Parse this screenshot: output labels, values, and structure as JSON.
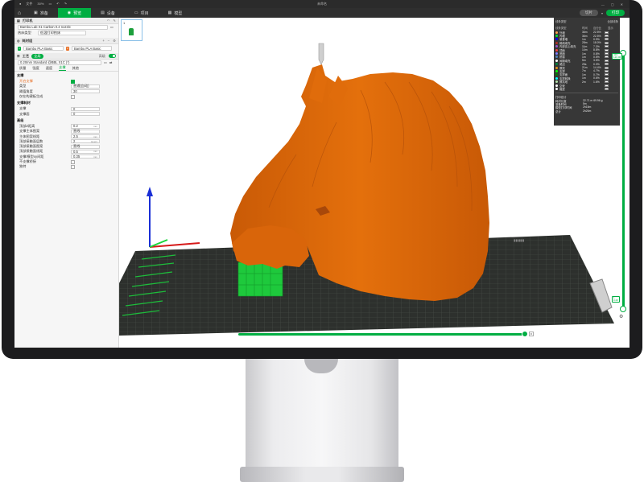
{
  "titlebar": {
    "file_menu": "文件",
    "zoom": "30%",
    "title": "未命名"
  },
  "navbar": {
    "home_icon": "home-icon",
    "tabs": [
      {
        "label": "准备",
        "active": false
      },
      {
        "label": "预览",
        "active": true
      },
      {
        "label": "设备",
        "active": false
      },
      {
        "label": "项目",
        "active": false
      },
      {
        "label": "模型",
        "active": false
      }
    ],
    "slice_button": "切片",
    "print_button": "打印"
  },
  "left_panel": {
    "printer_section": "打印机",
    "printer_name": "Bambu Lab X1 Carbon 0.4 nozzle",
    "plate_type_label": "热床类型",
    "plate_type_value": "低温打印热床",
    "filament_section": "耗材组",
    "filaments": [
      {
        "index": "1",
        "name": "Bambu PLA Basic",
        "color": "#00ae42"
      },
      {
        "index": "2",
        "name": "Bambu PLA Basic",
        "color": "#e8722b"
      }
    ],
    "process_section": "工艺",
    "process_badge": "全局",
    "advanced_label": "高级",
    "profile_value": "0.20mm Standard @BBL X1C (*)",
    "subtabs": [
      "质量",
      "强度",
      "速度",
      "支撑",
      "其他"
    ],
    "active_subtab": "支撑",
    "groups": [
      {
        "title": "支撑",
        "params": [
          {
            "label": "开启支撑",
            "value": "",
            "type": "checkbox",
            "checked": true,
            "orange": true
          },
          {
            "label": "类型",
            "value": "普通(自动)",
            "type": "select"
          },
          {
            "label": "阈值角度",
            "value": "30",
            "type": "value",
            "unit": ""
          },
          {
            "label": "仅在构建板生成",
            "value": "",
            "type": "checkbox",
            "checked": false
          }
        ]
      },
      {
        "title": "支撑耗材",
        "params": [
          {
            "label": "支撑",
            "value": "0",
            "type": "select"
          },
          {
            "label": "支撑面",
            "value": "0",
            "type": "select"
          }
        ]
      },
      {
        "title": "高级",
        "params": [
          {
            "label": "顶部Z距离",
            "value": "0.2",
            "type": "value",
            "unit": "mm"
          },
          {
            "label": "支撑主体图案",
            "value": "直线",
            "type": "select"
          },
          {
            "label": "主体图案线距",
            "value": "2.5",
            "type": "value",
            "unit": "mm"
          },
          {
            "label": "顶部接触面层数",
            "value": "2",
            "type": "value",
            "unit": "layers"
          },
          {
            "label": "顶部接触面图案",
            "value": "直线",
            "type": "select"
          },
          {
            "label": "顶部接触面线距",
            "value": "0.5",
            "type": "value",
            "unit": "mm"
          },
          {
            "label": "支撑/模型xy间距",
            "value": "0.35",
            "type": "value",
            "unit": "mm"
          },
          {
            "label": "不支撑桥接",
            "value": "",
            "type": "checkbox",
            "checked": false
          },
          {
            "label": "独特",
            "value": "",
            "type": "checkbox",
            "checked": false
          }
        ]
      }
    ]
  },
  "viewport": {
    "plate_number": "1",
    "slider_top_label": "419\n120.06",
    "slider_bottom_label": "1\n0.20",
    "hslider_label": "0"
  },
  "legend": {
    "view_type": "线条类型",
    "mode": "全部线条",
    "columns": [
      "线条类型",
      "时间",
      "百分比",
      "显示"
    ],
    "rows": [
      {
        "name": "外墙",
        "time": "36m",
        "percent": "22.5%",
        "color": "#ffa14b"
      },
      {
        "name": "内墙",
        "time": "36m",
        "percent": "22.5%",
        "color": "#00e63a"
      },
      {
        "name": "悬垂墙",
        "time": "1m",
        "percent": "0.9%",
        "color": "#0000ff"
      },
      {
        "name": "稀疏填充",
        "time": "28m",
        "percent": "18.0%",
        "color": "#b03029"
      },
      {
        "name": "内部实心填充",
        "time": "11m",
        "percent": "7.3%",
        "color": "#9654cc"
      },
      {
        "name": "顶面",
        "time": "14m",
        "percent": "8.8%",
        "color": "#f04040"
      },
      {
        "name": "底面",
        "time": "1m",
        "percent": "0.8%",
        "color": "#7d7dff"
      },
      {
        "name": "桥接",
        "time": "1m",
        "percent": "0.5%",
        "color": "#4d80ba"
      },
      {
        "name": "间隙填充",
        "time": "5m",
        "percent": "3.5%",
        "color": "#ffffff"
      },
      {
        "name": "裙边",
        "time": "25s",
        "percent": "0.3%",
        "color": "#00873d"
      },
      {
        "name": "擦拭",
        "time": "21m",
        "percent": "14.4%",
        "color": "#e09016"
      },
      {
        "name": "支撑",
        "time": "7m",
        "percent": "4.7%",
        "color": "#00ff00"
      },
      {
        "name": "支撑面",
        "time": "1m",
        "percent": "0.7%",
        "color": "#008000"
      },
      {
        "name": "支撑转换",
        "time": "1m",
        "percent": "0.6%",
        "color": "#00ffff"
      },
      {
        "name": "擦拭塔",
        "time": "2m",
        "percent": "1.6%",
        "color": "#b3e3ab"
      },
      {
        "name": "空驶",
        "time": "",
        "percent": "",
        "color": "#ffffff"
      },
      {
        "name": "缩进",
        "time": "",
        "percent": "",
        "color": "#ffffff"
      }
    ],
    "footer_title": "打印总计",
    "footer": [
      {
        "label": "耗材长度",
        "value": "22.71 m   69.96 g"
      },
      {
        "label": "准备时间",
        "value": "5m"
      },
      {
        "label": "模型打印时间",
        "value": "2h15m"
      },
      {
        "label": "总计",
        "value": "2h20m"
      }
    ]
  }
}
